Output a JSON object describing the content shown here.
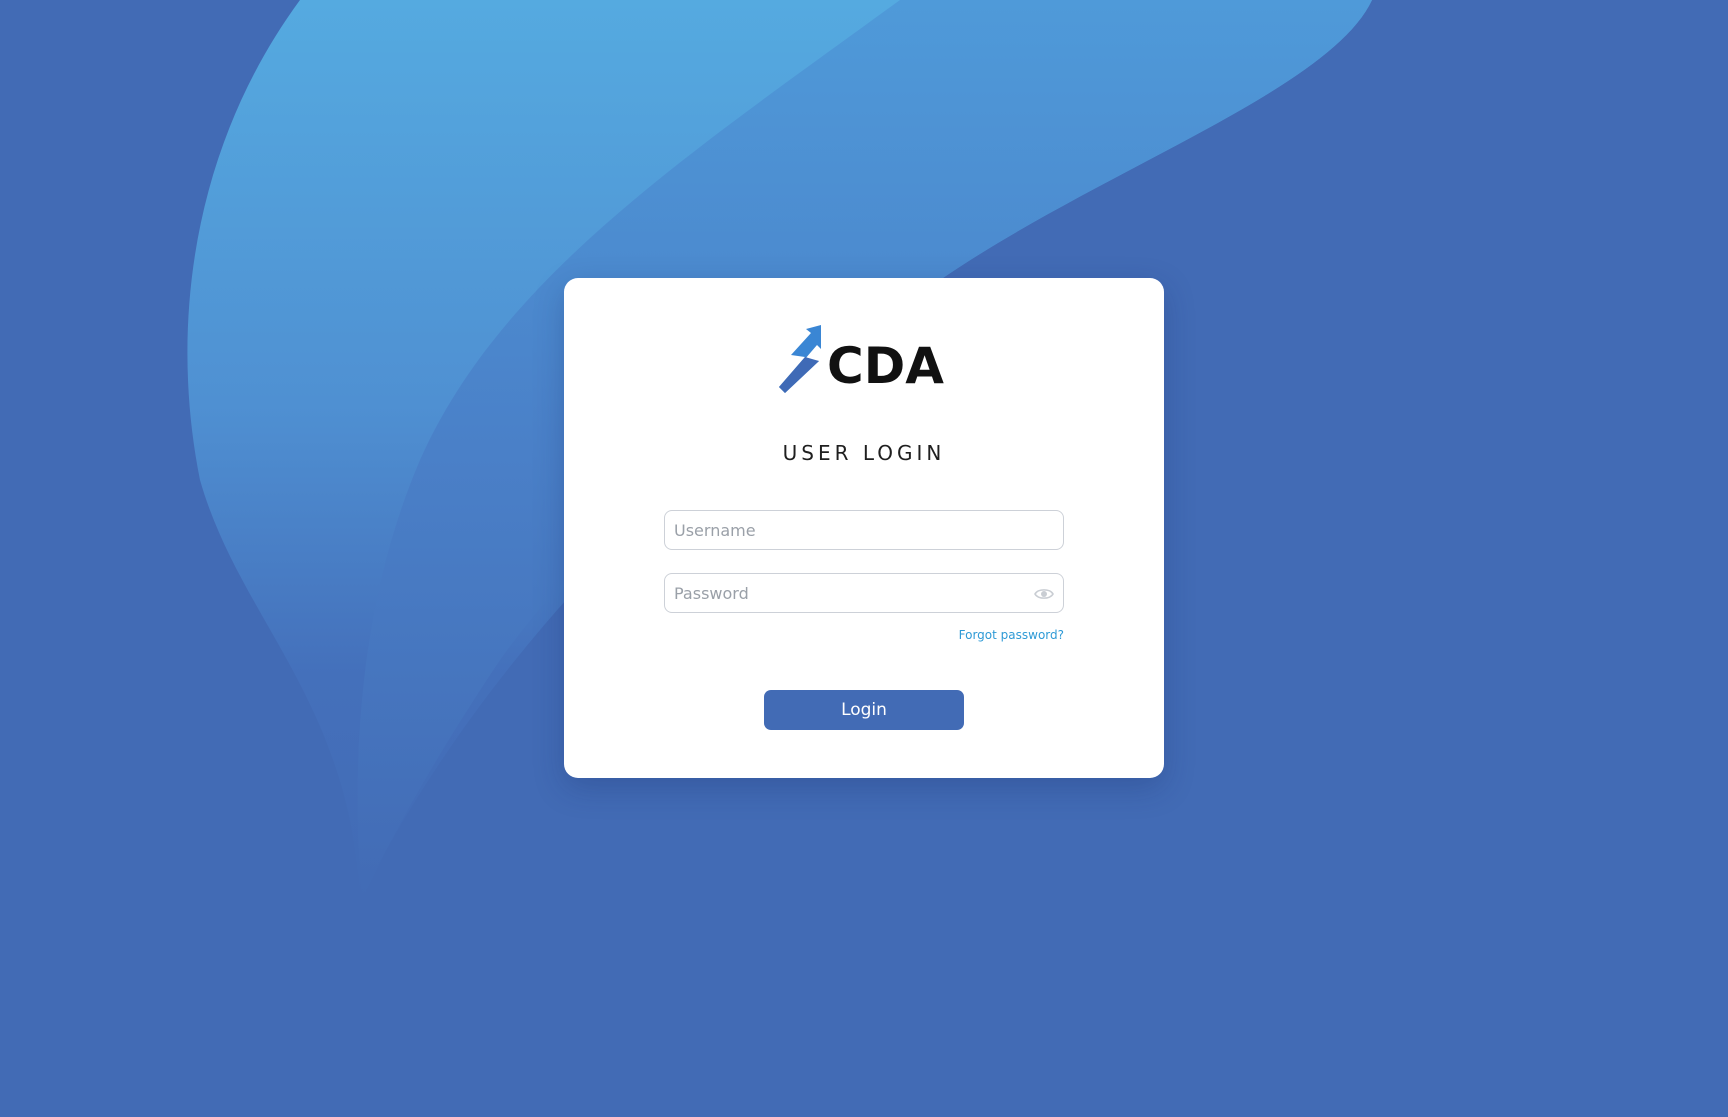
{
  "colors": {
    "background": "#426bb5",
    "wave_light": "#55a9e0",
    "wave_mid": "#4f93d3",
    "accent": "#2e9ad6",
    "button": "#426bb5",
    "card": "#ffffff"
  },
  "logo": {
    "text": "CDA",
    "icon": "lightning-arrow-icon"
  },
  "login": {
    "title": "USER LOGIN",
    "username_placeholder": "Username",
    "username_value": "",
    "password_placeholder": "Password",
    "password_value": "",
    "password_toggle_icon": "eye-icon",
    "forgot_label": "Forgot password?",
    "submit_label": "Login"
  }
}
